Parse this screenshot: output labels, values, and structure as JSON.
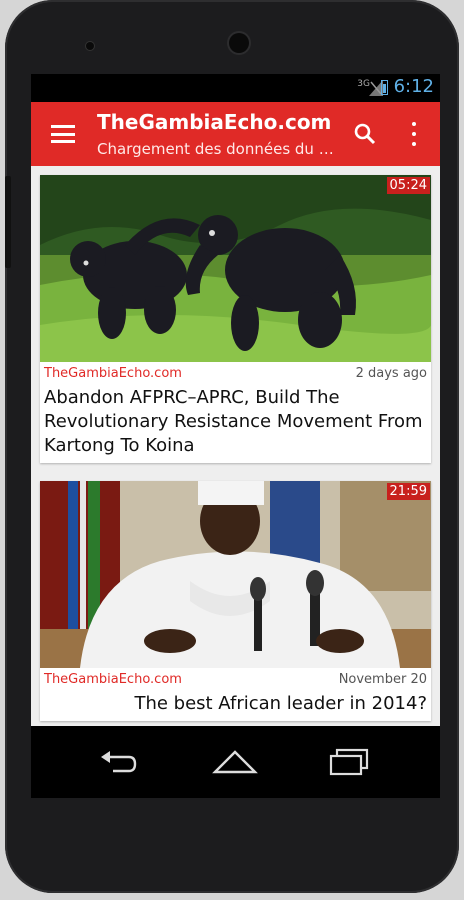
{
  "status_bar": {
    "network": "3G",
    "time": "6:12"
  },
  "app_bar": {
    "title": "TheGambiaEcho.com",
    "subtitle": "Chargement des données du fi…",
    "icons": [
      "menu-icon",
      "search-icon",
      "more-vert-icon"
    ]
  },
  "feed": {
    "cards": [
      {
        "duration": "05:24",
        "source": "TheGambiaEcho.com",
        "date": "2 days ago",
        "headline": "Abandon AFPRC–APRC, Build The Revolutionary Resistance Movement From Kartong To Koina"
      },
      {
        "duration": "21:59",
        "source": "TheGambiaEcho.com",
        "date": "November 20",
        "headline": "The best African leader in 2014?"
      }
    ]
  },
  "nav_bar": {
    "icons": [
      "back-icon",
      "home-icon",
      "recent-apps-icon"
    ]
  },
  "colors": {
    "accent": "#e02a27",
    "status_clock": "#5fb0e6"
  }
}
